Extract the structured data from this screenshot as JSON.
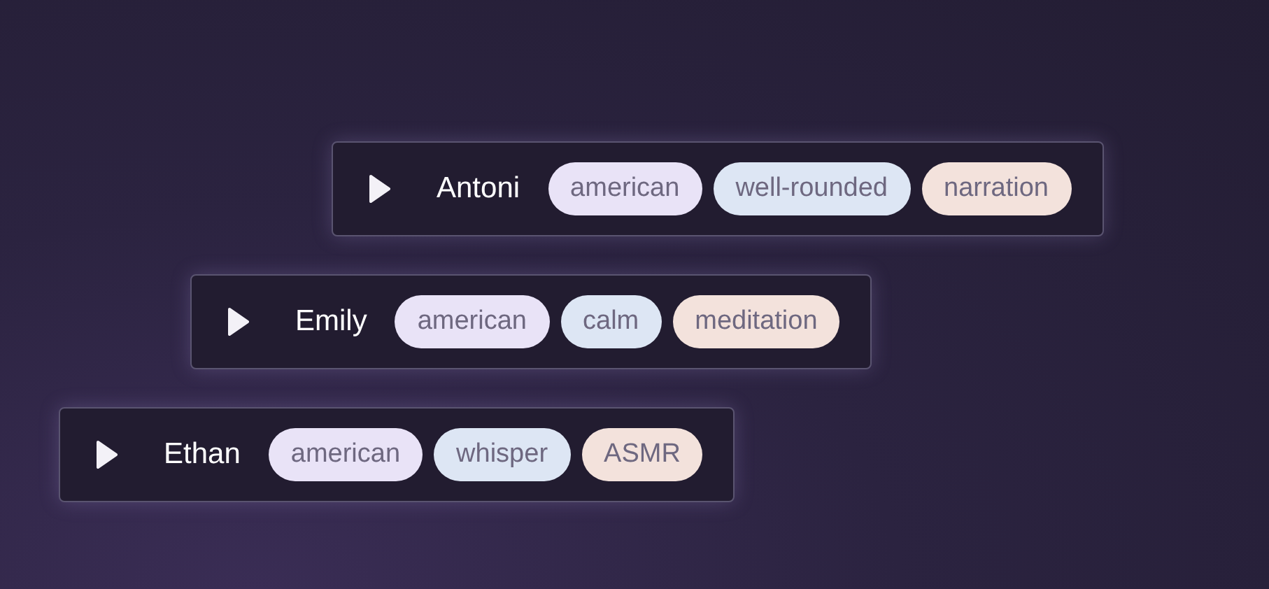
{
  "voices": [
    {
      "name": "Antoni",
      "tags": [
        {
          "label": "american",
          "color": "#e9e3f7"
        },
        {
          "label": "well-rounded",
          "color": "#dde6f4"
        },
        {
          "label": "narration",
          "color": "#f3e2dc"
        }
      ]
    },
    {
      "name": "Emily",
      "tags": [
        {
          "label": "american",
          "color": "#e9e3f7"
        },
        {
          "label": "calm",
          "color": "#dde6f4"
        },
        {
          "label": "meditation",
          "color": "#f3e2dc"
        }
      ]
    },
    {
      "name": "Ethan",
      "tags": [
        {
          "label": "american",
          "color": "#e9e3f7"
        },
        {
          "label": "whisper",
          "color": "#dde6f4"
        },
        {
          "label": "ASMR",
          "color": "#f3e2dc"
        }
      ]
    }
  ]
}
